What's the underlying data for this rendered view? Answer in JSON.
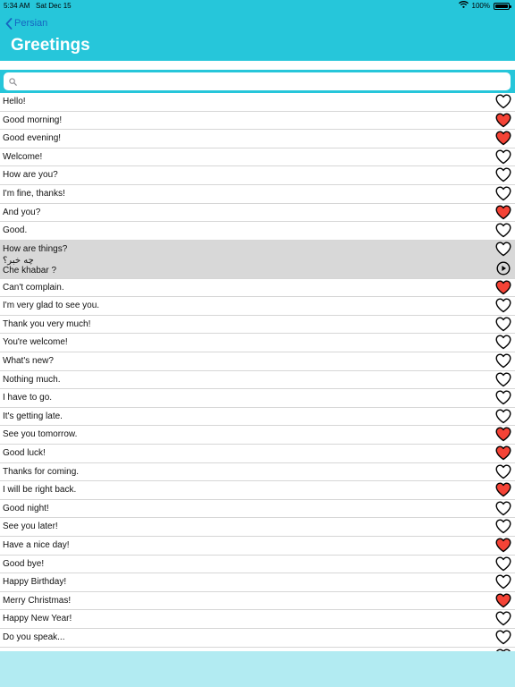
{
  "status": {
    "time": "5:34 AM",
    "date": "Sat Dec 15",
    "battery": "100%",
    "battery_level": 1.0
  },
  "nav": {
    "back_label": "Persian",
    "title": "Greetings"
  },
  "search": {
    "value": "",
    "placeholder": ""
  },
  "colors": {
    "header": "#26c6da",
    "favorite": "#f44336",
    "selected_row": "#d8d8d8",
    "back_link": "#1565c0"
  },
  "phrases": [
    {
      "label": "Hello!",
      "favorite": false
    },
    {
      "label": "Good morning!",
      "favorite": true
    },
    {
      "label": "Good evening!",
      "favorite": true
    },
    {
      "label": "Welcome!",
      "favorite": false
    },
    {
      "label": "How are you?",
      "favorite": false
    },
    {
      "label": "I'm fine, thanks!",
      "favorite": false
    },
    {
      "label": "And you?",
      "favorite": true
    },
    {
      "label": "Good.",
      "favorite": false
    },
    {
      "label": "How are things?",
      "favorite": false,
      "expanded": true,
      "native": "چه خبر؟",
      "transliteration": "Che khabar ?"
    },
    {
      "label": "Can't complain.",
      "favorite": true
    },
    {
      "label": "I'm very glad to see you.",
      "favorite": false
    },
    {
      "label": "Thank you very much!",
      "favorite": false
    },
    {
      "label": "You're welcome!",
      "favorite": false
    },
    {
      "label": "What's new?",
      "favorite": false
    },
    {
      "label": "Nothing much.",
      "favorite": false
    },
    {
      "label": "I have to go.",
      "favorite": false
    },
    {
      "label": "It's getting late.",
      "favorite": false
    },
    {
      "label": "See you tomorrow.",
      "favorite": true
    },
    {
      "label": "Good luck!",
      "favorite": true
    },
    {
      "label": "Thanks for coming.",
      "favorite": false
    },
    {
      "label": "I will be right back.",
      "favorite": true
    },
    {
      "label": "Good night!",
      "favorite": false
    },
    {
      "label": "See you later!",
      "favorite": false
    },
    {
      "label": "Have a nice day!",
      "favorite": true
    },
    {
      "label": "Good bye!",
      "favorite": false
    },
    {
      "label": "Happy Birthday!",
      "favorite": false
    },
    {
      "label": "Merry Christmas!",
      "favorite": true
    },
    {
      "label": "Happy New Year!",
      "favorite": false
    },
    {
      "label": "Do you speak...",
      "favorite": false
    },
    {
      "label": "",
      "favorite": false
    }
  ]
}
